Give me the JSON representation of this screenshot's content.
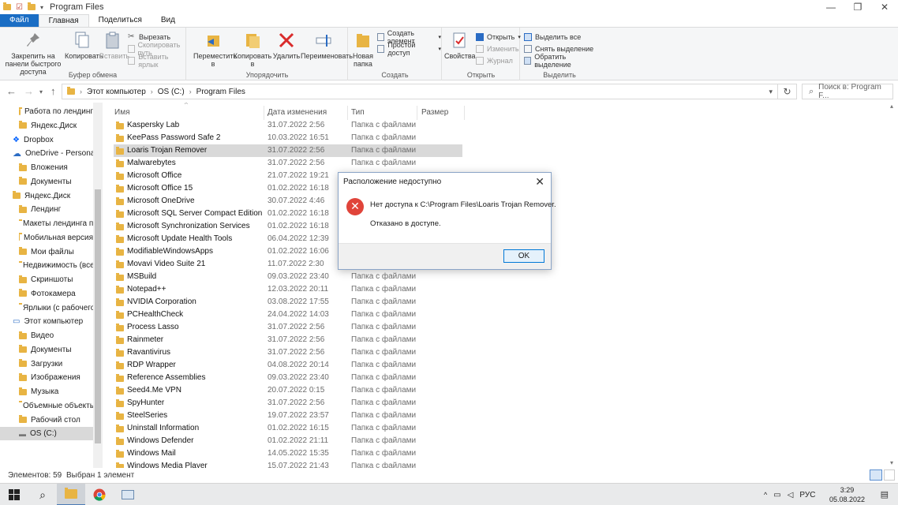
{
  "window": {
    "title": "Program Files",
    "buttons": [
      "—",
      "❐",
      "✕"
    ]
  },
  "ribbon_tabs": [
    "Файл",
    "Главная",
    "Поделиться",
    "Вид"
  ],
  "ribbon": {
    "clipboard": {
      "pin_label": "Закрепить на панели быстрого доступа",
      "copy_label": "Копировать",
      "paste_label": "Вставить",
      "cut_label": "Вырезать",
      "copy_path_label": "Скопировать путь",
      "paste_shortcut_label": "Вставить ярлык",
      "group_label": "Буфер обмена"
    },
    "organize": {
      "move_label": "Переместить в",
      "copy_to_label": "Копировать в",
      "delete_label": "Удалить",
      "rename_label": "Переименовать",
      "group_label": "Упорядочить"
    },
    "new": {
      "new_folder_label": "Новая папка",
      "new_item_label": "Создать элемент",
      "easy_access_label": "Простой доступ",
      "group_label": "Создать"
    },
    "open": {
      "properties_label": "Свойства",
      "open_label": "Открыть",
      "edit_label": "Изменить",
      "history_label": "Журнал",
      "group_label": "Открыть"
    },
    "select": {
      "select_all_label": "Выделить все",
      "select_none_label": "Снять выделение",
      "invert_label": "Обратить выделение",
      "group_label": "Выделить"
    }
  },
  "address": {
    "crumbs": [
      "Этот компьютер",
      "OS (C:)",
      "Program Files"
    ],
    "search_placeholder": "Поиск в: Program F..."
  },
  "nav_items": [
    {
      "label": "Работа по лендинг",
      "icon": "folder"
    },
    {
      "label": "Яндекс.Диск",
      "icon": "folder"
    },
    {
      "label": "Dropbox",
      "icon": "dropbox"
    },
    {
      "label": "OneDrive - Personal",
      "icon": "cloud"
    },
    {
      "label": "Вложения",
      "icon": "folder"
    },
    {
      "label": "Документы",
      "icon": "folder"
    },
    {
      "label": "Яндекс.Диск",
      "icon": "folder"
    },
    {
      "label": "Лендинг",
      "icon": "folder"
    },
    {
      "label": "Макеты лендинга п",
      "icon": "folder"
    },
    {
      "label": "Мобильная версия",
      "icon": "folder"
    },
    {
      "label": "Мои файлы",
      "icon": "folder"
    },
    {
      "label": "Недвижимость (все",
      "icon": "folder"
    },
    {
      "label": "Скриншоты",
      "icon": "folder"
    },
    {
      "label": "Фотокамера",
      "icon": "folder"
    },
    {
      "label": "Ярлыки (с рабочего",
      "icon": "folder"
    },
    {
      "label": "Этот компьютер",
      "icon": "computer"
    },
    {
      "label": "Видео",
      "icon": "folder"
    },
    {
      "label": "Документы",
      "icon": "folder"
    },
    {
      "label": "Загрузки",
      "icon": "folder"
    },
    {
      "label": "Изображения",
      "icon": "folder"
    },
    {
      "label": "Музыка",
      "icon": "folder"
    },
    {
      "label": "Объемные объекты",
      "icon": "folder"
    },
    {
      "label": "Рабочий стол",
      "icon": "folder"
    },
    {
      "label": "OS (C:)",
      "icon": "drive"
    }
  ],
  "columns": [
    "Имя",
    "Дата изменения",
    "Тип",
    "Размер"
  ],
  "files": [
    {
      "name": "Kaspersky Lab",
      "date": "31.07.2022 2:56",
      "type": "Папка с файлами"
    },
    {
      "name": "KeePass Password Safe 2",
      "date": "10.03.2022 16:51",
      "type": "Папка с файлами"
    },
    {
      "name": "Loaris Trojan Remover",
      "date": "31.07.2022 2:56",
      "type": "Папка с файлами"
    },
    {
      "name": "Malwarebytes",
      "date": "31.07.2022 2:56",
      "type": "Папка с файлами"
    },
    {
      "name": "Microsoft Office",
      "date": "21.07.2022 19:21",
      "type": ""
    },
    {
      "name": "Microsoft Office 15",
      "date": "01.02.2022 16:18",
      "type": ""
    },
    {
      "name": "Microsoft OneDrive",
      "date": "30.07.2022 4:46",
      "type": ""
    },
    {
      "name": "Microsoft SQL Server Compact Edition",
      "date": "01.02.2022 16:18",
      "type": ""
    },
    {
      "name": "Microsoft Synchronization Services",
      "date": "01.02.2022 16:18",
      "type": ""
    },
    {
      "name": "Microsoft Update Health Tools",
      "date": "06.04.2022 12:39",
      "type": ""
    },
    {
      "name": "ModifiableWindowsApps",
      "date": "01.02.2022 16:06",
      "type": ""
    },
    {
      "name": "Movavi Video Suite 21",
      "date": "11.07.2022 2:30",
      "type": ""
    },
    {
      "name": "MSBuild",
      "date": "09.03.2022 23:40",
      "type": "Папка с файлами"
    },
    {
      "name": "Notepad++",
      "date": "12.03.2022 20:11",
      "type": "Папка с файлами"
    },
    {
      "name": "NVIDIA Corporation",
      "date": "03.08.2022 17:55",
      "type": "Папка с файлами"
    },
    {
      "name": "PCHealthCheck",
      "date": "24.04.2022 14:03",
      "type": "Папка с файлами"
    },
    {
      "name": "Process Lasso",
      "date": "31.07.2022 2:56",
      "type": "Папка с файлами"
    },
    {
      "name": "Rainmeter",
      "date": "31.07.2022 2:56",
      "type": "Папка с файлами"
    },
    {
      "name": "Ravantivirus",
      "date": "31.07.2022 2:56",
      "type": "Папка с файлами"
    },
    {
      "name": "RDP Wrapper",
      "date": "04.08.2022 20:14",
      "type": "Папка с файлами"
    },
    {
      "name": "Reference Assemblies",
      "date": "09.03.2022 23:40",
      "type": "Папка с файлами"
    },
    {
      "name": "Seed4.Me VPN",
      "date": "20.07.2022 0:15",
      "type": "Папка с файлами"
    },
    {
      "name": "SpyHunter",
      "date": "31.07.2022 2:56",
      "type": "Папка с файлами"
    },
    {
      "name": "SteelSeries",
      "date": "19.07.2022 23:57",
      "type": "Папка с файлами"
    },
    {
      "name": "Uninstall Information",
      "date": "01.02.2022 16:15",
      "type": "Папка с файлами"
    },
    {
      "name": "Windows Defender",
      "date": "01.02.2022 21:11",
      "type": "Папка с файлами"
    },
    {
      "name": "Windows Mail",
      "date": "14.05.2022 15:35",
      "type": "Папка с файлами"
    },
    {
      "name": "Windows Media Player",
      "date": "15.07.2022 21:43",
      "type": "Папка с файлами"
    }
  ],
  "status": {
    "count": "Элементов: 59",
    "selected": "Выбран 1 элемент"
  },
  "taskbar": {
    "lang": "РУС",
    "time": "3:29",
    "date": "05.08.2022"
  },
  "dialog": {
    "title": "Расположение недоступно",
    "message": "Нет доступа к C:\\Program Files\\Loaris Trojan Remover.",
    "detail": "Отказано в доступе.",
    "ok_label": "OK"
  },
  "colors": {
    "accent": "#1a6dc4",
    "folder": "#e8b443",
    "error": "#e0443a",
    "selection": "#d9d9d9"
  }
}
